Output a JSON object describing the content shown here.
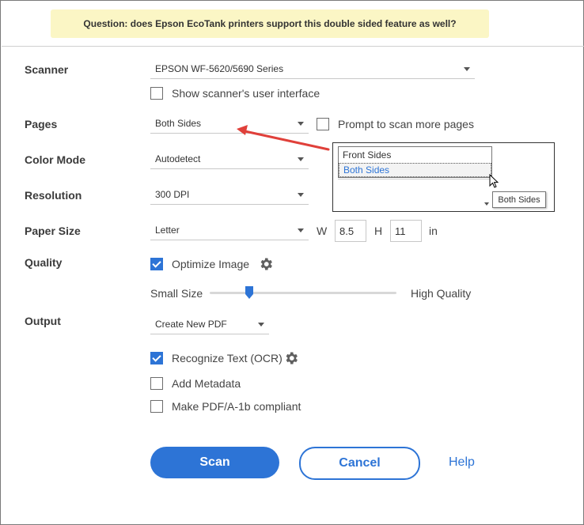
{
  "note": {
    "text": "Question: does Epson EcoTank printers support this double sided feature as well?"
  },
  "labels": {
    "scanner": "Scanner",
    "pages": "Pages",
    "color_mode": "Color Mode",
    "resolution": "Resolution",
    "paper_size": "Paper Size",
    "quality": "Quality",
    "output": "Output"
  },
  "scanner": {
    "selected": "EPSON WF-5620/5690 Series",
    "show_ui_label": "Show scanner's user interface",
    "show_ui_checked": false
  },
  "pages": {
    "selected": "Both Sides",
    "prompt_label": "Prompt to scan more pages",
    "prompt_checked": false
  },
  "color_mode": {
    "selected": "Autodetect"
  },
  "resolution": {
    "selected": "300 DPI"
  },
  "paper_size": {
    "selected": "Letter",
    "w_label": "W",
    "w_value": "8.5",
    "h_label": "H",
    "h_value": "11",
    "unit": "in"
  },
  "quality": {
    "optimize_label": "Optimize Image",
    "optimize_checked": true,
    "small_label": "Small Size",
    "high_label": "High Quality",
    "slider_value": 0.21
  },
  "output": {
    "selected": "Create New PDF",
    "ocr_label": "Recognize Text (OCR)",
    "ocr_checked": true,
    "metadata_label": "Add Metadata",
    "metadata_checked": false,
    "pdfa_label": "Make PDF/A-1b compliant",
    "pdfa_checked": false
  },
  "buttons": {
    "scan": "Scan",
    "cancel": "Cancel",
    "help": "Help"
  },
  "inset": {
    "options": [
      "Front Sides",
      "Both Sides"
    ],
    "selected_index": 1,
    "tooltip": "Both Sides"
  },
  "colors": {
    "accent": "#2d74d6",
    "annotation_arrow": "#e0403a",
    "note_bg": "#fbf6c5"
  },
  "icons": [
    "gear-icon",
    "chevron-down-icon",
    "checkmark-icon",
    "mouse-cursor-icon",
    "annotation-arrow-icon"
  ]
}
